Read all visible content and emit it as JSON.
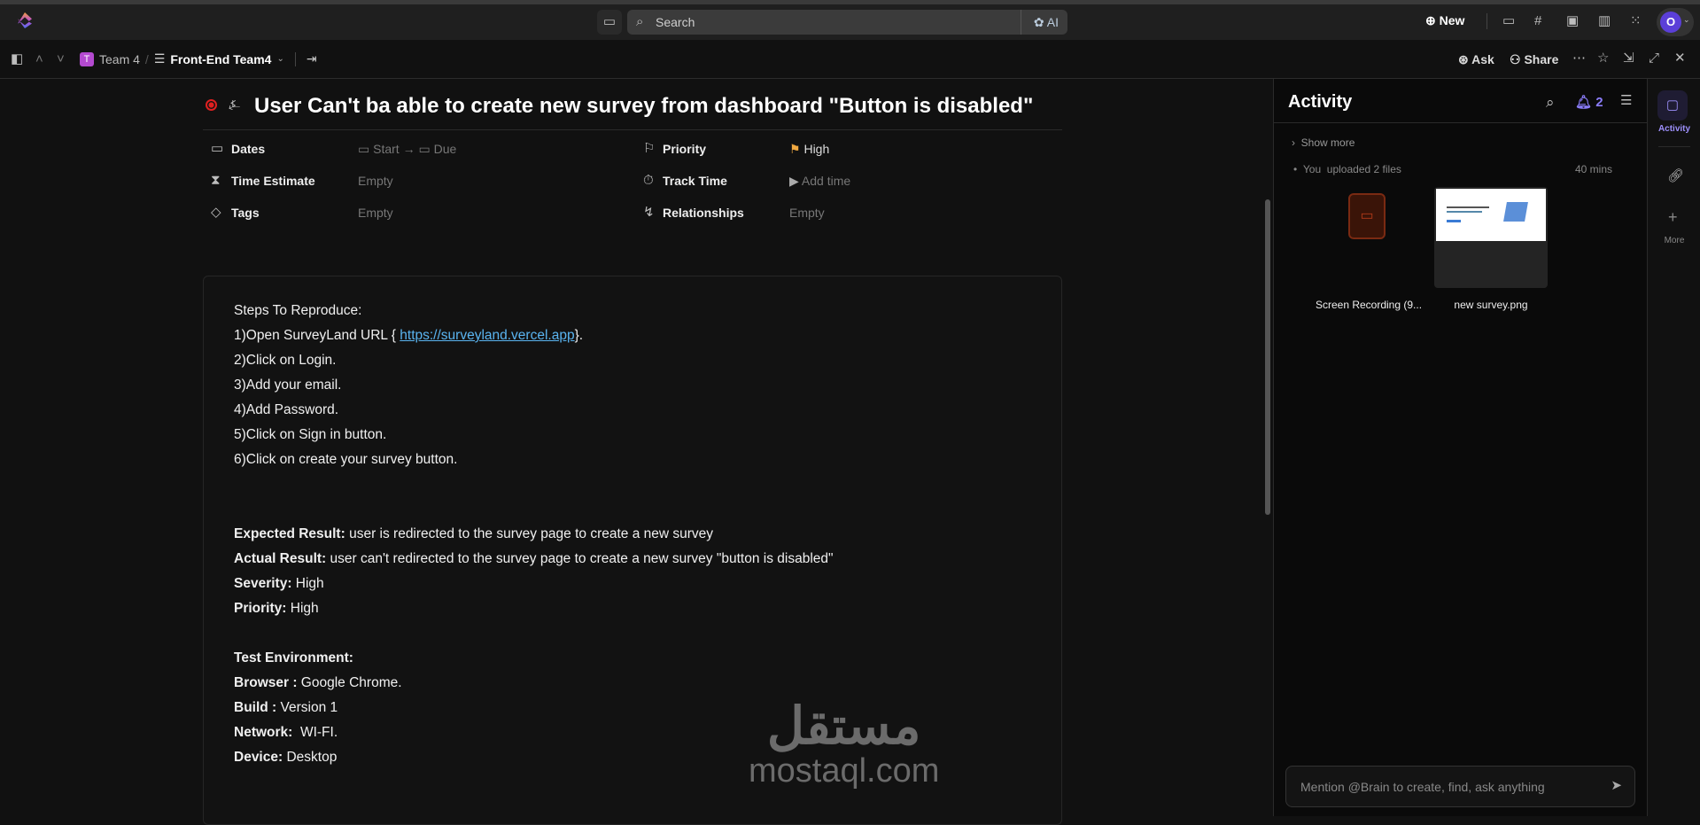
{
  "topbar": {
    "search_placeholder": "Search",
    "ai_label": "AI",
    "new_label": "New",
    "avatar_initial": "O"
  },
  "breadcrumb": {
    "space_initial": "T",
    "space": "Team 4",
    "separator": "/",
    "list": "Front-End Team4"
  },
  "actions": {
    "ask": "Ask",
    "share": "Share"
  },
  "task": {
    "title": "User Can't ba able to create new survey from dashboard \"Button is disabled\"",
    "properties": {
      "dates_label": "Dates",
      "start": "Start",
      "due": "Due",
      "time_estimate_label": "Time Estimate",
      "time_estimate_value": "Empty",
      "tags_label": "Tags",
      "tags_value": "Empty",
      "priority_label": "Priority",
      "priority_value": "High",
      "track_time_label": "Track Time",
      "track_time_value": "Add time",
      "relationships_label": "Relationships",
      "relationships_value": "Empty"
    },
    "description": {
      "steps_heading": "Steps To Reproduce:",
      "step1_prefix": "1)Open SurveyLand URL { ",
      "step1_link": "https://surveyland.vercel.app",
      "step1_suffix": "}.",
      "step2": "2)Click on Login.",
      "step3": "3)Add your email.",
      "step4": "4)Add Password.",
      "step5": "5)Click on Sign in button.",
      "step6": "6)Click on create your survey button.",
      "expected_label": "Expected Result:",
      "expected": " user is redirected to the survey page to create a new survey",
      "actual_label": "Actual Result:",
      "actual": " user can't redirected to the survey page to create a new survey \"button is disabled\"",
      "severity_label": "Severity:",
      "severity": " High",
      "priority_label": "Priority:",
      "priority": " High",
      "env_heading": "Test Environment:",
      "browser_label": "Browser :",
      "browser": " Google Chrome.",
      "build_label": "Build :",
      "build": " Version 1",
      "network_label": "Network:",
      "network": "  WI-FI.",
      "device_label": "Device:",
      "device": " Desktop"
    }
  },
  "activity": {
    "title": "Activity",
    "notifications": "2",
    "show_more": "Show more",
    "event_user": "You",
    "event_text": "uploaded 2 files",
    "event_time": "40 mins",
    "files": [
      {
        "name": "Screen Recording (9..."
      },
      {
        "name": "new survey.png"
      }
    ],
    "mention_placeholder": "Mention @Brain to create, find, ask anything"
  },
  "rail": {
    "activity": "Activity",
    "more": "More"
  },
  "watermark": {
    "arabic": "مستقل",
    "latin": "mostaql.com"
  },
  "colors": {
    "accent": "#7b68ee",
    "link": "#5ab4f0",
    "priority_flag": "#f0a840",
    "status_red": "#e02020"
  }
}
